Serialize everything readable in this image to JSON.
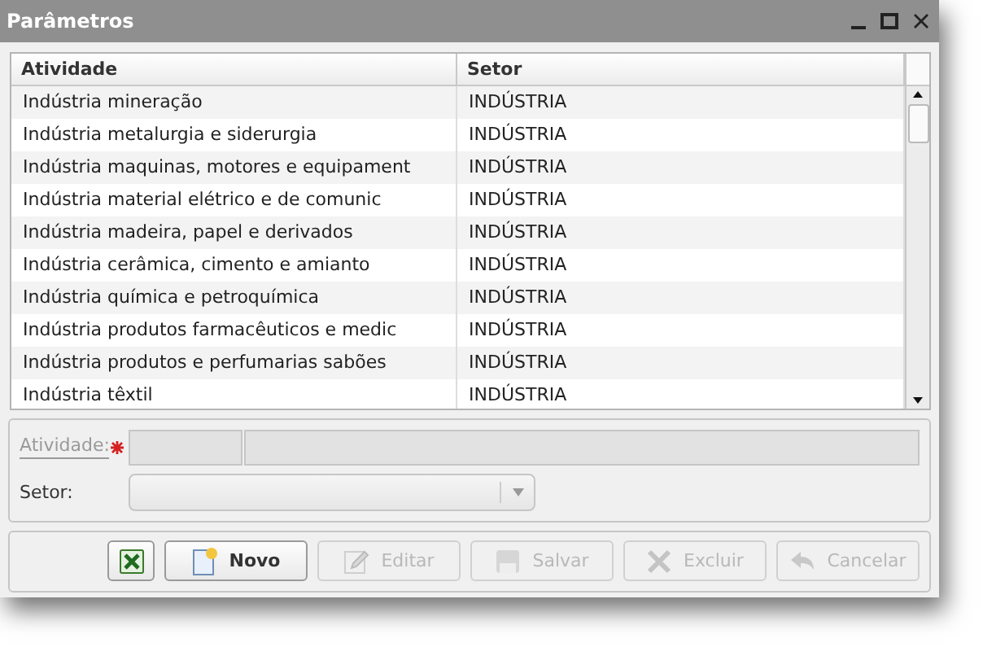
{
  "window": {
    "title": "Parâmetros"
  },
  "table": {
    "columns": [
      "Atividade",
      "Setor"
    ],
    "rows": [
      {
        "cells": [
          "Indústria mineração",
          "INDÚSTRIA"
        ]
      },
      {
        "cells": [
          "Indústria metalurgia e siderurgia",
          "INDÚSTRIA"
        ]
      },
      {
        "cells": [
          "Indústria maquinas, motores e equipament",
          "INDÚSTRIA"
        ]
      },
      {
        "cells": [
          "Indústria material elétrico e de comunic",
          "INDÚSTRIA"
        ]
      },
      {
        "cells": [
          "Indústria madeira, papel e derivados",
          "INDÚSTRIA"
        ]
      },
      {
        "cells": [
          "Indústria cerâmica, cimento e amianto",
          "INDÚSTRIA"
        ]
      },
      {
        "cells": [
          "Indústria química e petroquímica",
          "INDÚSTRIA"
        ]
      },
      {
        "cells": [
          "Indústria produtos farmacêuticos e medic",
          "INDÚSTRIA"
        ]
      },
      {
        "cells": [
          "Indústria produtos e perfumarias sabões",
          "INDÚSTRIA"
        ]
      },
      {
        "cells": [
          "Indústria têxtil",
          "INDÚSTRIA"
        ]
      }
    ]
  },
  "form": {
    "activity": {
      "label": "Atividade:",
      "required": true
    },
    "sector": {
      "label": "Setor:"
    }
  },
  "buttons": [
    {
      "kind": "excel",
      "disabled": false
    },
    {
      "kind": "new",
      "label": "Novo",
      "disabled": false
    },
    {
      "kind": "edit",
      "label": "Editar",
      "disabled": true
    },
    {
      "kind": "save",
      "label": "Salvar",
      "disabled": true
    },
    {
      "kind": "delete",
      "label": "Excluir",
      "disabled": true
    },
    {
      "kind": "cancel",
      "label": "Cancelar",
      "disabled": true
    }
  ]
}
